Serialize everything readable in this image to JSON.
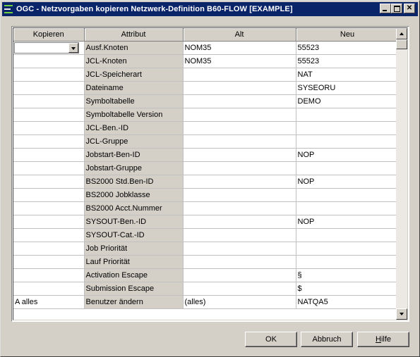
{
  "window": {
    "title": "OGC - Netzvorgaben kopieren Netzwerk-Definition B60-FLOW [EXAMPLE]"
  },
  "grid": {
    "columns": [
      "Kopieren",
      "Attribut",
      "Alt",
      "Neu"
    ],
    "rows": [
      {
        "kopieren": "",
        "attribut": "Ausf.Knoten",
        "alt": "NOM35",
        "neu": "55523"
      },
      {
        "kopieren": "",
        "attribut": "JCL-Knoten",
        "alt": "NOM35",
        "neu": "55523"
      },
      {
        "kopieren": "",
        "attribut": "JCL-Speicherart",
        "alt": "",
        "neu": "NAT"
      },
      {
        "kopieren": "",
        "attribut": "Dateiname",
        "alt": "",
        "neu": "SYSEORU"
      },
      {
        "kopieren": "",
        "attribut": "Symboltabelle",
        "alt": "",
        "neu": "DEMO"
      },
      {
        "kopieren": "",
        "attribut": "Symboltabelle Version",
        "alt": "",
        "neu": ""
      },
      {
        "kopieren": "",
        "attribut": "JCL-Ben.-ID",
        "alt": "",
        "neu": ""
      },
      {
        "kopieren": "",
        "attribut": "JCL-Gruppe",
        "alt": "",
        "neu": ""
      },
      {
        "kopieren": "",
        "attribut": "Jobstart-Ben-ID",
        "alt": "",
        "neu": "NOP"
      },
      {
        "kopieren": "",
        "attribut": "Jobstart-Gruppe",
        "alt": "",
        "neu": ""
      },
      {
        "kopieren": "",
        "attribut": "BS2000 Std.Ben-ID",
        "alt": "",
        "neu": "NOP"
      },
      {
        "kopieren": "",
        "attribut": "BS2000 Jobklasse",
        "alt": "",
        "neu": ""
      },
      {
        "kopieren": "",
        "attribut": "BS2000 Acct.Nummer",
        "alt": "",
        "neu": ""
      },
      {
        "kopieren": "",
        "attribut": "SYSOUT-Ben.-ID",
        "alt": "",
        "neu": "NOP"
      },
      {
        "kopieren": "",
        "attribut": "SYSOUT-Cat.-ID",
        "alt": "",
        "neu": ""
      },
      {
        "kopieren": "",
        "attribut": "Job Priorität",
        "alt": "",
        "neu": ""
      },
      {
        "kopieren": "",
        "attribut": "Lauf Priorität",
        "alt": "",
        "neu": ""
      },
      {
        "kopieren": "",
        "attribut": "Activation Escape",
        "alt": "",
        "neu": "§"
      },
      {
        "kopieren": "",
        "attribut": "Submission Escape",
        "alt": "",
        "neu": "$"
      },
      {
        "kopieren": "A alles",
        "attribut": "Benutzer ändern",
        "alt": "(alles)",
        "neu": "NATQA5"
      }
    ]
  },
  "buttons": {
    "ok": "OK",
    "cancel": "Abbruch",
    "help_first": "H",
    "help_rest": "ilfe"
  }
}
